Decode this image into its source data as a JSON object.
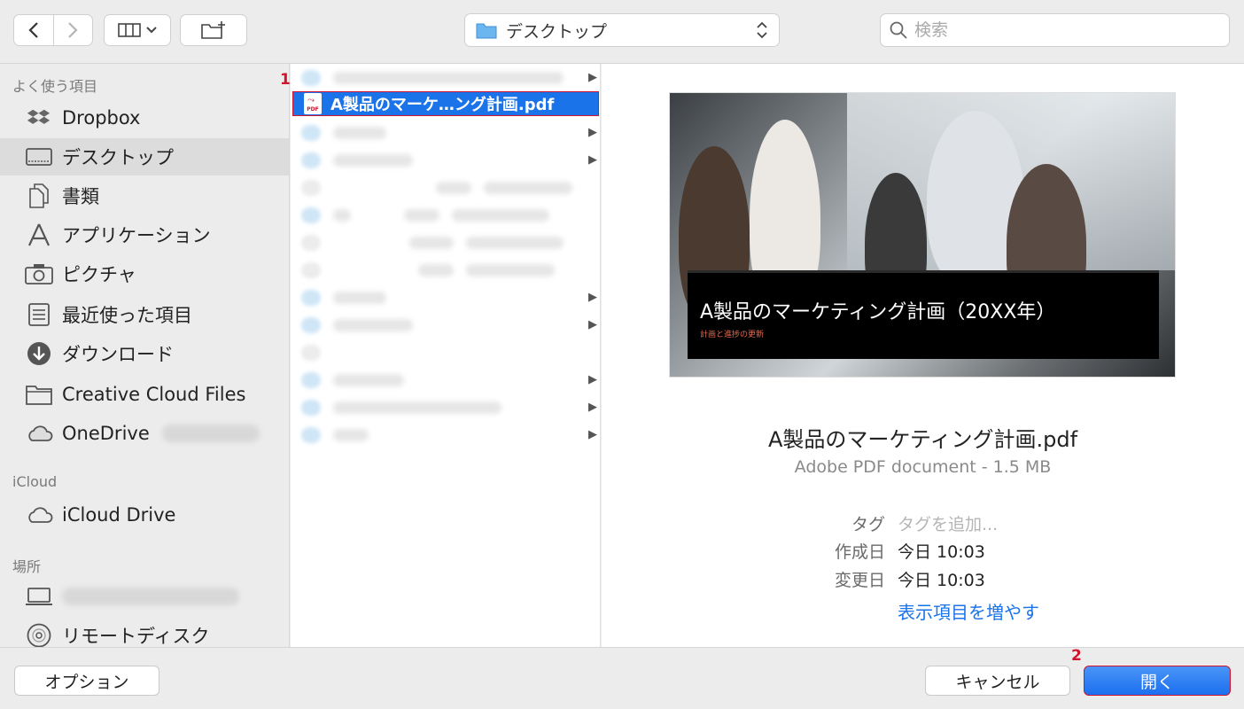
{
  "toolbar": {
    "view_icon": "column-view-icon",
    "new_folder_icon": "new-folder-icon",
    "location": "デスクトップ",
    "search_placeholder": "検索"
  },
  "sidebar": {
    "favorites_header": "よく使う項目",
    "favorites": [
      {
        "label": "Dropbox",
        "icon": "dropbox-icon"
      },
      {
        "label": "デスクトップ",
        "icon": "desktop-icon",
        "selected": true
      },
      {
        "label": "書類",
        "icon": "documents-icon"
      },
      {
        "label": "アプリケーション",
        "icon": "applications-icon"
      },
      {
        "label": "ピクチャ",
        "icon": "camera-icon"
      },
      {
        "label": "最近使った項目",
        "icon": "recents-icon"
      },
      {
        "label": "ダウンロード",
        "icon": "download-icon"
      },
      {
        "label": "Creative Cloud Files",
        "icon": "folder-icon"
      },
      {
        "label": "OneDrive",
        "icon": "cloud-icon"
      }
    ],
    "icloud_header": "iCloud",
    "icloud": [
      {
        "label": "iCloud Drive",
        "icon": "cloud-icon"
      }
    ],
    "locations_header": "場所",
    "locations": [
      {
        "label": "",
        "icon": "laptop-icon"
      },
      {
        "label": "リモートディスク",
        "icon": "disc-icon"
      }
    ]
  },
  "file_list": {
    "selected_file": "A製品のマーケ…ング計画.pdf"
  },
  "preview": {
    "thumb_title": "A製品のマーケティング計画（20XX年）",
    "thumb_subtitle": "計画と進捗の更新",
    "file_name": "A製品のマーケティング計画.pdf",
    "file_kind": "Adobe PDF document - 1.5 MB",
    "tag_label": "タグ",
    "tag_placeholder": "タグを追加...",
    "created_label": "作成日",
    "created_value": "今日 10:03",
    "modified_label": "変更日",
    "modified_value": "今日 10:03",
    "more_link": "表示項目を増やす"
  },
  "footer": {
    "options_label": "オプション",
    "cancel_label": "キャンセル",
    "open_label": "開く"
  },
  "annotations": {
    "step1": "1",
    "step2": "2"
  },
  "colors": {
    "accent": "#1a73e8",
    "highlight_border": "#d0142c"
  }
}
